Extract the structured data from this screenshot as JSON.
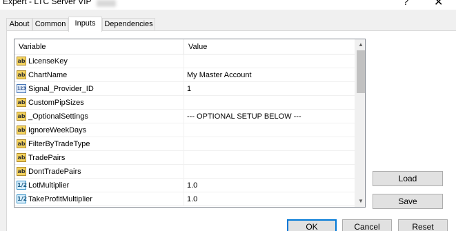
{
  "window": {
    "title": "Expert - LTC Server VIP",
    "help_glyph": "?",
    "close_glyph": "✕"
  },
  "tabs": [
    {
      "label": "About"
    },
    {
      "label": "Common"
    },
    {
      "label": "Inputs",
      "active": true
    },
    {
      "label": "Dependencies"
    }
  ],
  "grid": {
    "headers": {
      "variable": "Variable",
      "value": "Value"
    },
    "rows": [
      {
        "type": "string",
        "icon": "ab",
        "name": "LicenseKey",
        "value": ""
      },
      {
        "type": "string",
        "icon": "ab",
        "name": "ChartName",
        "value": "My Master Account"
      },
      {
        "type": "int",
        "icon": "123",
        "name": "Signal_Provider_ID",
        "value": "1"
      },
      {
        "type": "string",
        "icon": "ab",
        "name": "CustomPipSizes",
        "value": ""
      },
      {
        "type": "string",
        "icon": "ab",
        "name": "_OptionalSettings",
        "value": "--- OPTIONAL SETUP BELOW ---"
      },
      {
        "type": "string",
        "icon": "ab",
        "name": "IgnoreWeekDays",
        "value": ""
      },
      {
        "type": "string",
        "icon": "ab",
        "name": "FilterByTradeType",
        "value": ""
      },
      {
        "type": "string",
        "icon": "ab",
        "name": "TradePairs",
        "value": ""
      },
      {
        "type": "string",
        "icon": "ab",
        "name": "DontTradePairs",
        "value": ""
      },
      {
        "type": "double",
        "icon": "1/2",
        "name": "LotMultiplier",
        "value": "1.0"
      },
      {
        "type": "double",
        "icon": "1/2",
        "name": "TakeProfitMultiplier",
        "value": "1.0"
      }
    ],
    "scroll_up_glyph": "▲",
    "scroll_down_glyph": "▼"
  },
  "side_buttons": {
    "load": "Load",
    "save": "Save"
  },
  "footer_buttons": {
    "ok": "OK",
    "cancel": "Cancel",
    "reset": "Reset"
  }
}
